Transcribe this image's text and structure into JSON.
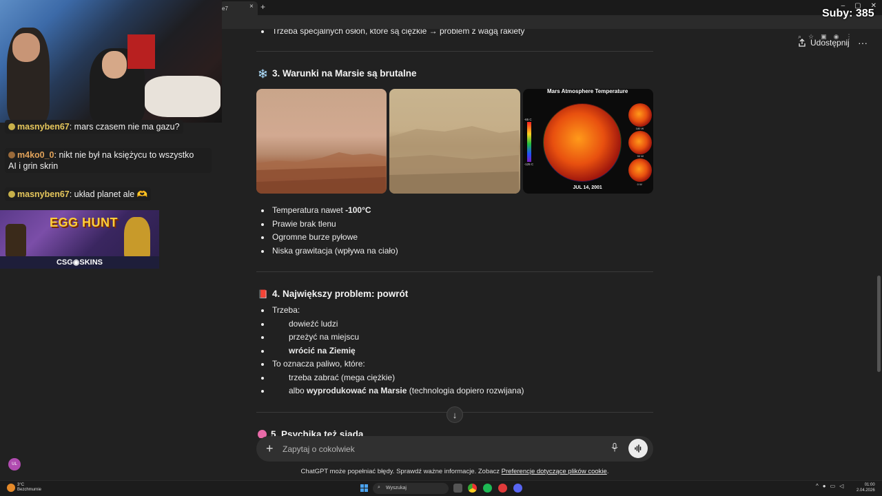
{
  "browser": {
    "tab_title": "e7",
    "tab_close": "×",
    "new_tab": "+",
    "window_controls": [
      "–",
      "▢",
      "✕"
    ]
  },
  "header": {
    "share_label": "Udostępnij",
    "more_label": "···"
  },
  "content": {
    "top_line": "Trzeba specjalnych osłon, które są ciężkie → problem z wagą rakiety",
    "section3": {
      "emoji": "❄️",
      "title": "3. Warunki na Marsie są brutalne",
      "image3": {
        "title": "Mars Atmosphere Temperature",
        "scale_top": "-65 C",
        "scale_bottom": "-125 C",
        "date": "JUL 14, 2001",
        "mini_labels": [
          "180 W",
          "90 W",
          "0 W"
        ]
      },
      "bullets": [
        {
          "prefix": "Temperatura nawet ",
          "bold": "-100°C"
        },
        {
          "text": "Prawie brak tlenu"
        },
        {
          "text": "Ogromne burze pyłowe"
        },
        {
          "text": "Niska grawitacja (wpływa na ciało)"
        }
      ]
    },
    "section4": {
      "emoji": "📕",
      "title": "4. Największy problem: powrót",
      "items": [
        {
          "text": "Trzeba:",
          "sub": [
            {
              "text": "dowieźć ludzi"
            },
            {
              "text": "przeżyć na miejscu"
            },
            {
              "bold": "wrócić na Ziemię"
            }
          ]
        },
        {
          "text": "To oznacza paliwo, które:",
          "sub": [
            {
              "text": "trzeba zabrać (mega ciężkie)"
            },
            {
              "prefix": "albo ",
              "bold": "wyprodukować na Marsie",
              "suffix": " (technologia dopiero rozwijana)"
            }
          ]
        }
      ]
    },
    "section5": {
      "title": "5. Psychika też siada"
    },
    "scroll_down_icon": "↓"
  },
  "composer": {
    "placeholder": "Zapytaj o cokolwiek",
    "plus": "+",
    "mic": "🎙",
    "voice": "|||"
  },
  "disclaimer": {
    "text": "ChatGPT może popełniać błędy. Sprawdź ważne informacje. Zobacz ",
    "link": "Preferencje dotyczące plików cookie",
    "end": "."
  },
  "overlay": {
    "subs": "Suby: 385",
    "chat": [
      {
        "user": "masnyben67",
        "text": ": mars czasem nie ma gazu?"
      },
      {
        "user": "m4ko0_0",
        "text": ": nikt nie był na księżycu to wszystko",
        "line2": "AI i grin skrin"
      },
      {
        "user": "masnyben67",
        "text": ": układ planet ale 🫶"
      }
    ],
    "banner_title": "EGG HUNT",
    "banner_brand": "CSG◉SKINS",
    "avatar": "UL"
  },
  "taskbar": {
    "weather_temp": "3°C",
    "weather_desc": "Bezchmurnie",
    "search": "Wyszukaj",
    "time": "01:00",
    "date": "2.04.2026"
  },
  "colors": {
    "background": "#212121",
    "composer": "#303030",
    "text": "#ececec"
  }
}
